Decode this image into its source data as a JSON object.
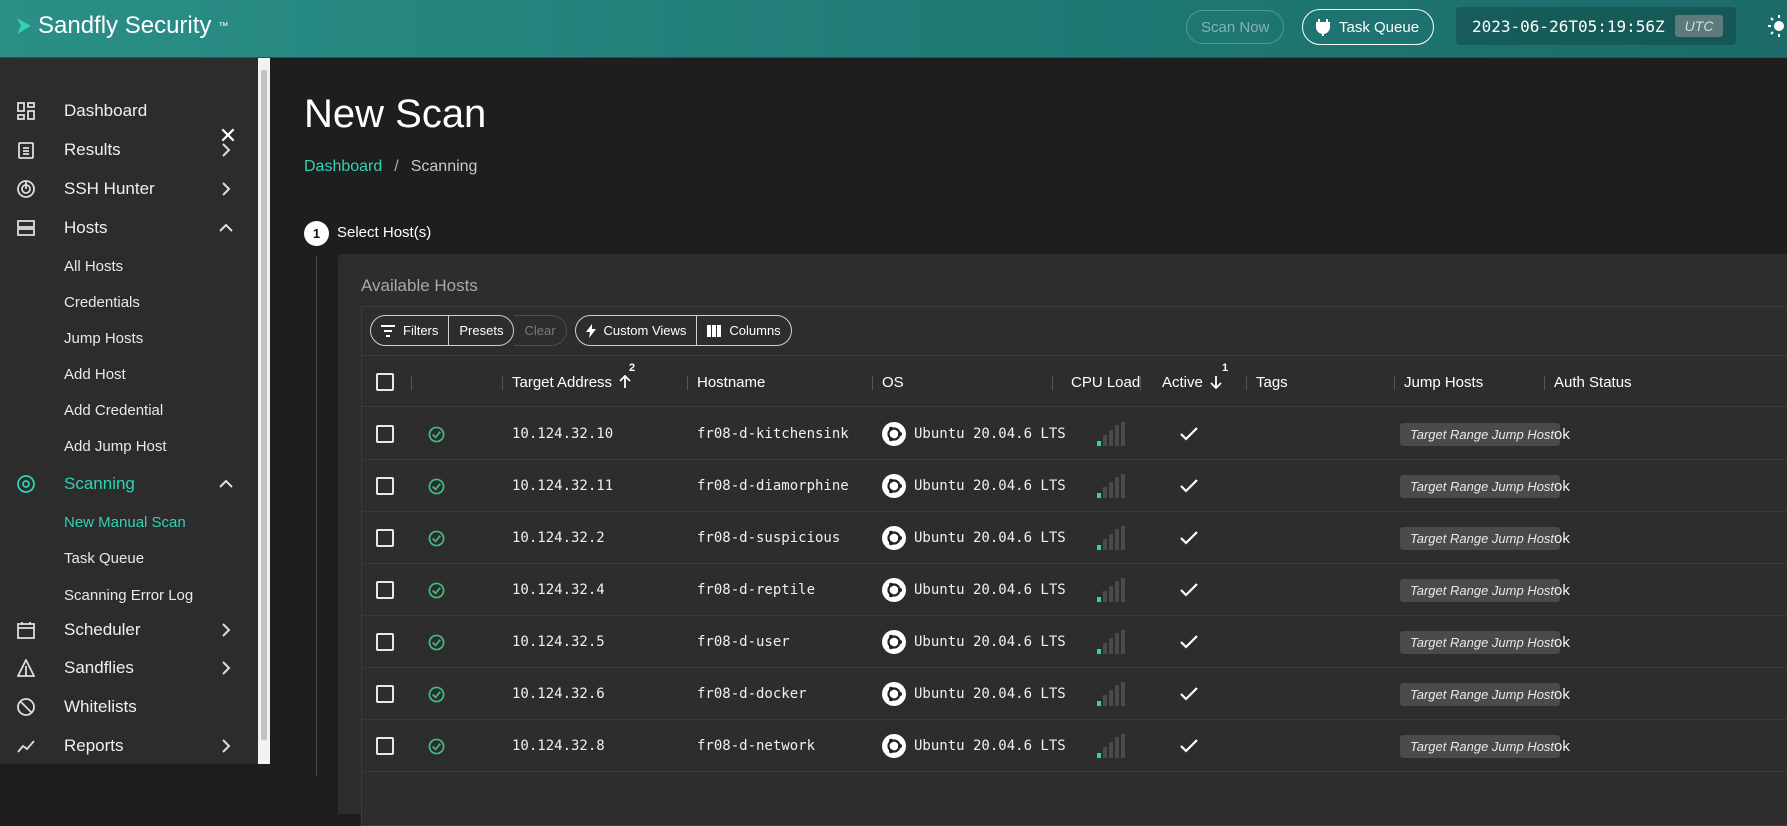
{
  "topbar": {
    "brand": "Sandfly Security",
    "brand_tm": "™",
    "scan_now": "Scan Now",
    "task_queue": "Task Queue",
    "timestamp": "2023-06-26T05:19:56Z",
    "timezone": "UTC"
  },
  "sidebar": {
    "items": [
      {
        "label": "Dashboard",
        "icon": "dashboard-icon"
      },
      {
        "label": "Results",
        "icon": "clipboard-icon"
      },
      {
        "label": "SSH Hunter",
        "icon": "radar-icon"
      },
      {
        "label": "Hosts",
        "icon": "server-icon"
      },
      {
        "label": "Scanning",
        "icon": "scan-icon"
      },
      {
        "label": "Scheduler",
        "icon": "calendar-icon"
      },
      {
        "label": "Sandflies",
        "icon": "sandfly-icon"
      },
      {
        "label": "Whitelists",
        "icon": "block-icon"
      },
      {
        "label": "Reports",
        "icon": "chart-line-icon"
      }
    ],
    "hosts_sub": [
      "All Hosts",
      "Credentials",
      "Jump Hosts",
      "Add Host",
      "Add Credential",
      "Add Jump Host"
    ],
    "scanning_sub": [
      "New Manual Scan",
      "Task Queue",
      "Scanning Error Log"
    ]
  },
  "main": {
    "title": "New Scan",
    "breadcrumb": {
      "link": "Dashboard",
      "sep": "/",
      "current": "Scanning"
    },
    "step_number": "1",
    "step_label": "Select Host(s)",
    "card_title": "Available Hosts",
    "toolbar": {
      "filters": "Filters",
      "presets": "Presets",
      "clear": "Clear",
      "custom_views": "Custom Views",
      "columns": "Columns"
    },
    "columns": {
      "target": "Target Address",
      "target_sort": "2",
      "hostname": "Hostname",
      "os": "OS",
      "cpu": "CPU Load",
      "active": "Active",
      "active_sort": "1",
      "tags": "Tags",
      "jump": "Jump Hosts",
      "auth": "Auth Status"
    },
    "rows": [
      {
        "ip": "10.124.32.10",
        "host": "fr08-d-kitchensink",
        "os": "Ubuntu 20.04.6 LTS",
        "jump": "Target Range Jump Host",
        "auth": "ok",
        "cpu_level": 1
      },
      {
        "ip": "10.124.32.11",
        "host": "fr08-d-diamorphine",
        "os": "Ubuntu 20.04.6 LTS",
        "jump": "Target Range Jump Host",
        "auth": "ok",
        "cpu_level": 1
      },
      {
        "ip": "10.124.32.2",
        "host": "fr08-d-suspicious",
        "os": "Ubuntu 20.04.6 LTS",
        "jump": "Target Range Jump Host",
        "auth": "ok",
        "cpu_level": 1
      },
      {
        "ip": "10.124.32.4",
        "host": "fr08-d-reptile",
        "os": "Ubuntu 20.04.6 LTS",
        "jump": "Target Range Jump Host",
        "auth": "ok",
        "cpu_level": 1
      },
      {
        "ip": "10.124.32.5",
        "host": "fr08-d-user",
        "os": "Ubuntu 20.04.6 LTS",
        "jump": "Target Range Jump Host",
        "auth": "ok",
        "cpu_level": 1
      },
      {
        "ip": "10.124.32.6",
        "host": "fr08-d-docker",
        "os": "Ubuntu 20.04.6 LTS",
        "jump": "Target Range Jump Host",
        "auth": "ok",
        "cpu_level": 1
      },
      {
        "ip": "10.124.32.8",
        "host": "fr08-d-network",
        "os": "Ubuntu 20.04.6 LTS",
        "jump": "Target Range Jump Host",
        "auth": "ok",
        "cpu_level": 1
      }
    ]
  },
  "colors": {
    "accent": "#2fd3b4",
    "topbar": "#2a8f87",
    "sidebar": "#2c2c2c",
    "background": "#1e1e1e"
  }
}
